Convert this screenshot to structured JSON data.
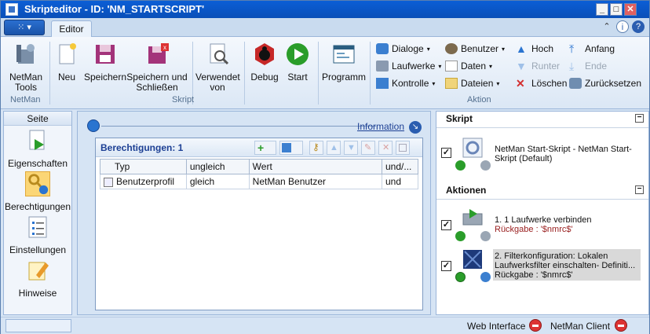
{
  "window": {
    "title": "Skripteditor - ID: 'NM_STARTSCRIPT'"
  },
  "ribbon": {
    "tab_editor": "Editor",
    "buttons": {
      "netman_tools": "NetMan Tools",
      "neu": "Neu",
      "speichern": "Speichern",
      "speichern_schliessen": "Speichern und Schließen",
      "verwendet_von": "Verwendet von",
      "debug": "Debug",
      "start": "Start",
      "programm": "Programm"
    },
    "actions": {
      "dialoge": "Dialoge",
      "laufwerke": "Laufwerke",
      "kontrolle": "Kontrolle",
      "benutzer": "Benutzer",
      "daten": "Daten",
      "dateien": "Dateien",
      "hoch": "Hoch",
      "runter": "Runter",
      "loeschen": "Löschen",
      "anfang": "Anfang",
      "ende": "Ende",
      "zuruecksetzen": "Zurücksetzen"
    },
    "groups": {
      "netman": "NetMan",
      "skript": "Skript",
      "aktion": "Aktion"
    }
  },
  "leftnav": {
    "header": "Seite",
    "items": [
      "Eigenschaften",
      "Berechtigungen",
      "Einstellungen",
      "Hinweise"
    ],
    "selected": "Berechtigungen"
  },
  "center": {
    "info_link": "Information",
    "grid_title": "Berechtigungen: 1",
    "columns": [
      "Typ",
      "ungleich",
      "Wert",
      "und/..."
    ],
    "rows": [
      {
        "typ": "Benutzerprofil",
        "ungleich": "gleich",
        "wert": "NetMan Benutzer",
        "und": "und"
      }
    ]
  },
  "right": {
    "skript_header": "Skript",
    "skript_item": "NetMan Start-Skript - NetMan Start-Skript (Default)",
    "aktionen_header": "Aktionen",
    "actions": [
      {
        "title": "1. 1 Laufwerke verbinden",
        "ret": "Rückgabe : '$nmrc$'"
      },
      {
        "title": "2. Filterkonfiguration: Lokalen Laufwerksfilter einschalten- Definiti...",
        "ret": "Rückgabe : '$nmrc$'"
      }
    ]
  },
  "status": {
    "web_interface": "Web Interface",
    "netman_client": "NetMan Client"
  }
}
